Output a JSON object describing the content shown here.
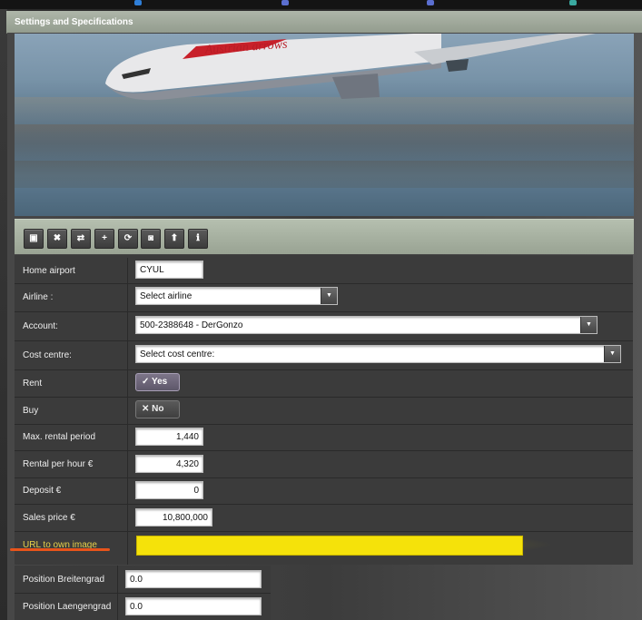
{
  "window": {
    "title": "Settings and Specifications"
  },
  "toolbar": {
    "buttons": [
      {
        "name": "save",
        "glyph": "▣"
      },
      {
        "name": "close",
        "glyph": "✖"
      },
      {
        "name": "swap",
        "glyph": "⇄"
      },
      {
        "name": "add",
        "glyph": "+"
      },
      {
        "name": "refresh",
        "glyph": "⟳"
      },
      {
        "name": "photo",
        "glyph": "◙"
      },
      {
        "name": "upload",
        "glyph": "⬆"
      },
      {
        "name": "info",
        "glyph": "ℹ"
      }
    ]
  },
  "form": {
    "home_airport": {
      "label": "Home airport",
      "value": "CYUL"
    },
    "airline": {
      "label": "Airline :",
      "value": "Select airline"
    },
    "account": {
      "label": "Account:",
      "value": "500-2388648 - DerGonzo"
    },
    "cost_centre": {
      "label": "Cost centre:",
      "value": "Select cost centre:"
    },
    "rent": {
      "label": "Rent",
      "value": "Yes"
    },
    "buy": {
      "label": "Buy",
      "value": "No"
    },
    "max_rental_period": {
      "label": "Max. rental period",
      "value": "1,440"
    },
    "rental_per_hour": {
      "label": "Rental per hour €",
      "value": "4,320"
    },
    "deposit": {
      "label": "Deposit €",
      "value": "0"
    },
    "sales_price": {
      "label": "Sales price €",
      "value": "10,800,000"
    },
    "url_own_image": {
      "label": "URL to own image",
      "value": ""
    },
    "position_breitengrad": {
      "label": "Position Breitengrad",
      "value": "0.0"
    },
    "position_laengengrad": {
      "label": "Position Laengengrad",
      "value": "0.0"
    }
  },
  "photo": {
    "livery_text": "Austrian arrows"
  },
  "colors": {
    "highlight": "#f5e20a",
    "underline": "#e8541b",
    "titlebar": "#a3ab9e"
  }
}
